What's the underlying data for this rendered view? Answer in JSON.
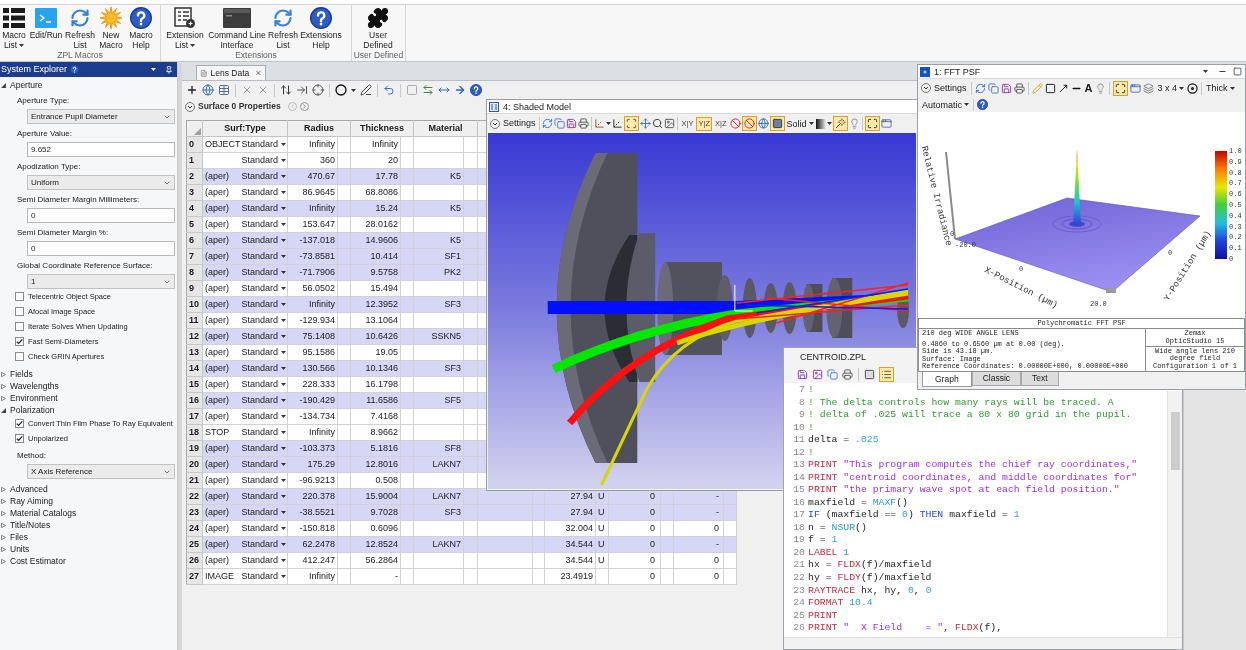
{
  "ribbon": {
    "groups": [
      {
        "label": "ZPL Macros",
        "buttons": [
          {
            "label": "Macro List",
            "dropdown": true
          },
          {
            "label": "Edit/Run",
            "dropdown": false
          },
          {
            "label": "Refresh List",
            "dropdown": false
          },
          {
            "label": "New Macro",
            "dropdown": false
          },
          {
            "label": "Macro Help",
            "dropdown": false
          }
        ]
      },
      {
        "label": "Extensions",
        "buttons": [
          {
            "label": "Extension List",
            "dropdown": true
          },
          {
            "label": "Command Line Interface",
            "dropdown": false
          },
          {
            "label": "Refresh List",
            "dropdown": false
          },
          {
            "label": "Extensions Help",
            "dropdown": false
          }
        ]
      },
      {
        "label": "User Defined",
        "buttons": [
          {
            "label": "User Defined",
            "dropdown": false
          }
        ]
      }
    ]
  },
  "system_explorer": {
    "title": "System Explorer",
    "sections": [
      {
        "label": "Aperture",
        "expanded": true,
        "items": [
          {
            "kind": "dropdown",
            "label": "Aperture Type:",
            "value": "Entrance Pupil Diameter"
          },
          {
            "kind": "input",
            "label": "Aperture Value:",
            "value": "9.652"
          },
          {
            "kind": "dropdown",
            "label": "Apodization Type:",
            "value": "Uniform"
          },
          {
            "kind": "input",
            "label": "Semi Diameter Margin Millimeters:",
            "value": "0"
          },
          {
            "kind": "input",
            "label": "Semi Diameter Margin %:",
            "value": "0"
          },
          {
            "kind": "dropdown",
            "label": "Global Coordinate Reference Surface:",
            "value": "1"
          },
          {
            "kind": "checkbox",
            "label": "Telecentric Object Space",
            "checked": false
          },
          {
            "kind": "checkbox",
            "label": "Afocal Image Space",
            "checked": false
          },
          {
            "kind": "checkbox",
            "label": "Iterate Solves When Updating",
            "checked": false
          },
          {
            "kind": "checkbox",
            "label": "Fast Semi-Diameters",
            "checked": true
          },
          {
            "kind": "checkbox",
            "label": "Check GRIN Apertures",
            "checked": false
          }
        ]
      },
      {
        "label": "Fields",
        "expanded": false
      },
      {
        "label": "Wavelengths",
        "expanded": false
      },
      {
        "label": "Environment",
        "expanded": false
      },
      {
        "label": "Polarization",
        "expanded": true,
        "items": [
          {
            "kind": "checkbox",
            "label": "Convert Thin Film Phase To Ray Equivalent",
            "checked": true
          },
          {
            "kind": "checkbox",
            "label": "Unpolarized",
            "checked": true
          },
          {
            "kind": "dropdown",
            "label": "Method:",
            "value": "X Axis Reference"
          }
        ]
      },
      {
        "label": "Advanced",
        "expanded": false
      },
      {
        "label": "Ray Aiming",
        "expanded": false
      },
      {
        "label": "Material Catalogs",
        "expanded": false
      },
      {
        "label": "Title/Notes",
        "expanded": false
      },
      {
        "label": "Files",
        "expanded": false
      },
      {
        "label": "Units",
        "expanded": false
      },
      {
        "label": "Cost Estimator",
        "expanded": false
      }
    ]
  },
  "lens_data": {
    "tab": "Lens Data",
    "surface_properties": "Surface 0 Properties",
    "columns": [
      "Surf:Type",
      "Radius",
      "Thickness",
      "Material"
    ],
    "rows": [
      {
        "number": "0",
        "comment": "OBJECT",
        "type": "Standard",
        "radius": "Infinity",
        "thickness": "Infinity",
        "highlighted": false
      },
      {
        "number": "1",
        "type": "Standard",
        "radius": "360",
        "thickness": "20",
        "highlighted": false
      },
      {
        "number": "2",
        "comment": "(aper)",
        "type": "Standard",
        "radius": "470.67",
        "thickness": "17.78",
        "material": "K5",
        "highlighted": true
      },
      {
        "number": "3",
        "comment": "(aper)",
        "type": "Standard",
        "radius": "86.9645",
        "thickness": "68.8086",
        "highlighted": false
      },
      {
        "number": "4",
        "comment": "(aper)",
        "type": "Standard",
        "radius": "Infinity",
        "thickness": "15.24",
        "material": "K5",
        "highlighted": true
      },
      {
        "number": "5",
        "comment": "(aper)",
        "type": "Standard",
        "radius": "153.647",
        "thickness": "28.0162",
        "highlighted": false
      },
      {
        "number": "6",
        "comment": "(aper)",
        "type": "Standard",
        "radius": "-137.018",
        "thickness": "14.9606",
        "material": "K5",
        "highlighted": true
      },
      {
        "number": "7",
        "comment": "(aper)",
        "type": "Standard",
        "radius": "-73.8581",
        "thickness": "10.414",
        "material": "SF1",
        "highlighted": true
      },
      {
        "number": "8",
        "comment": "(aper)",
        "type": "Standard",
        "radius": "-71.7906",
        "thickness": "9.5758",
        "material": "PK2",
        "highlighted": true
      },
      {
        "number": "9",
        "comment": "(aper)",
        "type": "Standard",
        "radius": "56.0502",
        "thickness": "15.494",
        "highlighted": false
      },
      {
        "number": "10",
        "comment": "(aper)",
        "type": "Standard",
        "radius": "Infinity",
        "thickness": "12.3952",
        "material": "SF3",
        "highlighted": true
      },
      {
        "number": "11",
        "comment": "(aper)",
        "type": "Standard",
        "radius": "-129.934",
        "thickness": "13.1064",
        "highlighted": false
      },
      {
        "number": "12",
        "comment": "(aper)",
        "type": "Standard",
        "radius": "75.1408",
        "thickness": "10.6426",
        "material": "SSKN5",
        "highlighted": true
      },
      {
        "number": "13",
        "comment": "(aper)",
        "type": "Standard",
        "radius": "95.1586",
        "thickness": "19.05",
        "highlighted": false
      },
      {
        "number": "14",
        "comment": "(aper)",
        "type": "Standard",
        "radius": "130.566",
        "thickness": "10.1346",
        "material": "SF3",
        "highlighted": true
      },
      {
        "number": "15",
        "comment": "(aper)",
        "type": "Standard",
        "radius": "228.333",
        "thickness": "16.1798",
        "highlighted": false
      },
      {
        "number": "16",
        "comment": "(aper)",
        "type": "Standard",
        "radius": "-190.429",
        "thickness": "11.6586",
        "material": "SF5",
        "highlighted": true
      },
      {
        "number": "17",
        "comment": "(aper)",
        "type": "Standard",
        "radius": "-134.734",
        "thickness": "7.4168",
        "highlighted": false
      },
      {
        "number": "18",
        "comment": "STOP",
        "type": "Standard",
        "radius": "Infinity",
        "thickness": "8.9662",
        "highlighted": false
      },
      {
        "number": "19",
        "comment": "(aper)",
        "type": "Standard",
        "radius": "-103.373",
        "thickness": "5.1816",
        "material": "SF8",
        "highlighted": true
      },
      {
        "number": "20",
        "comment": "(aper)",
        "type": "Standard",
        "radius": "175.29",
        "thickness": "12.8016",
        "material": "LAKN7",
        "highlighted": true
      },
      {
        "number": "21",
        "comment": "(aper)",
        "type": "Standard",
        "radius": "-96.9213",
        "thickness": "0.508",
        "highlighted": false
      },
      {
        "number": "22",
        "comment": "(aper)",
        "type": "Standard",
        "radius": "220.378",
        "thickness": "15.9004",
        "material": "LAKN7",
        "highlighted": true,
        "column_7": "27.94",
        "column_7_solve": "U",
        "column_8": "0",
        "column_9": "-"
      },
      {
        "number": "23",
        "comment": "(aper)",
        "type": "Standard",
        "radius": "-38.5521",
        "thickness": "9.7028",
        "material": "SF3",
        "highlighted": true,
        "column_7": "27.94",
        "column_7_solve": "U",
        "column_8": "0",
        "column_9": "-"
      },
      {
        "number": "24",
        "comment": "(aper)",
        "type": "Standard",
        "radius": "-150.818",
        "thickness": "0.6096",
        "highlighted": false,
        "column_7": "32.004",
        "column_7_solve": "U",
        "column_8": "0",
        "column_9": "0"
      },
      {
        "number": "25",
        "comment": "(aper)",
        "type": "Standard",
        "radius": "62.2478",
        "thickness": "12.8524",
        "material": "LAKN7",
        "highlighted": true,
        "column_7": "34.544",
        "column_7_solve": "U",
        "column_8": "0",
        "column_9": "-"
      },
      {
        "number": "26",
        "comment": "(aper)",
        "type": "Standard",
        "radius": "412.247",
        "thickness": "56.2864",
        "highlighted": false,
        "column_7": "34.544",
        "column_7_solve": "U",
        "column_8": "0",
        "column_9": "0"
      },
      {
        "number": "27",
        "comment": "IMAGE",
        "type": "Standard",
        "radius": "Infinity",
        "thickness": "-",
        "highlighted": false,
        "column_7": "23.4919",
        "column_8": "0",
        "column_9": "0"
      }
    ]
  },
  "shaded_model_window": {
    "title": "4: Shaded Model",
    "settings": "Settings",
    "view_buttons": [
      {
        "label": "X|Y",
        "selected": false
      },
      {
        "label": "Y|Z",
        "selected": true
      },
      {
        "label": "X|Z",
        "selected": false
      }
    ],
    "render_dropdown": "Solid",
    "toggles": [
      {
        "on": true
      },
      {
        "on": false
      },
      {
        "on": true
      },
      {
        "on": true
      },
      {
        "on": true
      },
      {
        "on": true
      }
    ]
  },
  "editor_window": {
    "title": "CENTROID.ZPL",
    "toggles": [
      {
        "on": true
      }
    ],
    "lines": [
      {
        "number": "7",
        "tokens": [
          {
            "kind": "comment",
            "text": "!"
          }
        ]
      },
      {
        "number": "8",
        "tokens": [
          {
            "kind": "comment",
            "text": "! The delta controls how many rays will be traced. A"
          }
        ]
      },
      {
        "number": "9",
        "tokens": [
          {
            "kind": "comment",
            "text": "! delta of .025 will trace a 80 x 80 grid in the pupil."
          }
        ]
      },
      {
        "number": "10",
        "tokens": [
          {
            "kind": "comment",
            "text": "!"
          }
        ]
      },
      {
        "number": "11",
        "tokens": [
          {
            "kind": "plain",
            "text": "delta = "
          },
          {
            "kind": "number",
            "text": ".025"
          }
        ]
      },
      {
        "number": "12",
        "tokens": [
          {
            "kind": "comment",
            "text": "!"
          }
        ]
      },
      {
        "number": "13",
        "tokens": [
          {
            "kind": "keyword",
            "text": "PRINT "
          },
          {
            "kind": "string",
            "text": "\"This program computes the chief ray coordinates,\""
          }
        ]
      },
      {
        "number": "14",
        "tokens": [
          {
            "kind": "keyword",
            "text": "PRINT "
          },
          {
            "kind": "string",
            "text": "\"centroid coordinates, and middle coordinates for\""
          }
        ]
      },
      {
        "number": "15",
        "tokens": [
          {
            "kind": "keyword",
            "text": "PRINT "
          },
          {
            "kind": "string",
            "text": "\"the primary wave spot at each field position.\""
          }
        ]
      },
      {
        "number": "16",
        "tokens": [
          {
            "kind": "plain",
            "text": "maxfield = "
          },
          {
            "kind": "function",
            "text": "MAXF"
          },
          {
            "kind": "plain",
            "text": "()"
          }
        ]
      },
      {
        "number": "17",
        "tokens": [
          {
            "kind": "control",
            "text": "IF"
          },
          {
            "kind": "plain",
            "text": " (maxfield == "
          },
          {
            "kind": "number",
            "text": "0"
          },
          {
            "kind": "plain",
            "text": ") "
          },
          {
            "kind": "control",
            "text": "THEN"
          },
          {
            "kind": "plain",
            "text": " maxfield = "
          },
          {
            "kind": "number",
            "text": "1"
          }
        ]
      },
      {
        "number": "18",
        "tokens": [
          {
            "kind": "plain",
            "text": "n = "
          },
          {
            "kind": "function",
            "text": "NSUR"
          },
          {
            "kind": "plain",
            "text": "()"
          }
        ]
      },
      {
        "number": "19",
        "tokens": [
          {
            "kind": "plain",
            "text": "f = "
          },
          {
            "kind": "number",
            "text": "1"
          }
        ]
      },
      {
        "number": "20",
        "tokens": [
          {
            "kind": "keyword",
            "text": "LABEL "
          },
          {
            "kind": "number",
            "text": "1"
          }
        ]
      },
      {
        "number": "21",
        "tokens": [
          {
            "kind": "plain",
            "text": "hx = "
          },
          {
            "kind": "keyword",
            "text": "FLDX"
          },
          {
            "kind": "plain",
            "text": "(f)/maxfield"
          }
        ]
      },
      {
        "number": "22",
        "tokens": [
          {
            "kind": "plain",
            "text": "hy = "
          },
          {
            "kind": "keyword",
            "text": "FLDY"
          },
          {
            "kind": "plain",
            "text": "(f)/maxfield"
          }
        ]
      },
      {
        "number": "23",
        "tokens": [
          {
            "kind": "keyword",
            "text": "RAYTRACE"
          },
          {
            "kind": "plain",
            "text": " hx, hy, "
          },
          {
            "kind": "number",
            "text": "0"
          },
          {
            "kind": "plain",
            "text": ", "
          },
          {
            "kind": "number",
            "text": "0"
          }
        ]
      },
      {
        "number": "24",
        "tokens": [
          {
            "kind": "keyword",
            "text": "FORMAT "
          },
          {
            "kind": "number",
            "text": "10.4"
          }
        ]
      },
      {
        "number": "25",
        "tokens": [
          {
            "kind": "keyword",
            "text": "PRINT"
          }
        ]
      },
      {
        "number": "26",
        "tokens": [
          {
            "kind": "keyword",
            "text": "PRINT "
          },
          {
            "kind": "string",
            "text": "\"  X Field    = \""
          },
          {
            "kind": "plain",
            "text": ", "
          },
          {
            "kind": "keyword",
            "text": "FLDX"
          },
          {
            "kind": "plain",
            "text": "(f),"
          }
        ]
      }
    ]
  },
  "psf_window": {
    "title": "1: FFT PSF",
    "settings": "Settings",
    "toolbar_letter": "A",
    "toolbar_dropdowns": [
      "3 x 4",
      "Thick"
    ],
    "display_dropdown": "Automatic",
    "toggles": [
      {
        "on": true
      }
    ],
    "plot": {
      "z_label": "Relative Irradiance",
      "z_tick": "0",
      "x_label": "X-Position (µm)",
      "x_ticks": [
        "-20.0",
        "0",
        "20.0"
      ],
      "y_label": "Y-Position (µm)",
      "y_tick": "0",
      "colorbar_ticks": [
        "1.0",
        "0.9",
        "0.8",
        "0.7",
        "0.6",
        "0.5",
        "0.4",
        "0.3",
        "0.2",
        "0.1",
        "0"
      ]
    },
    "info": {
      "title": "Polychromatic FFT PSF",
      "left_title": "210 deg WIDE ANGLE LENS",
      "left_lines": [
        "0.4860 to 0.6560 µm at 0.00 (deg).",
        "Side is 43.18 µm.",
        "Surface: Image",
        "Reference Coordinates: 0.00000E+000, 0.00000E+000"
      ],
      "right_top": [
        "Zemax",
        "OpticStudio 15"
      ],
      "right_bottom": [
        "Wide angle lens 210 degree field",
        "Configuration 1 of 1"
      ]
    },
    "tabs": [
      {
        "label": "Graph",
        "selected": true
      },
      {
        "label": "Classic",
        "selected": false
      },
      {
        "label": "Text",
        "selected": false
      }
    ]
  }
}
